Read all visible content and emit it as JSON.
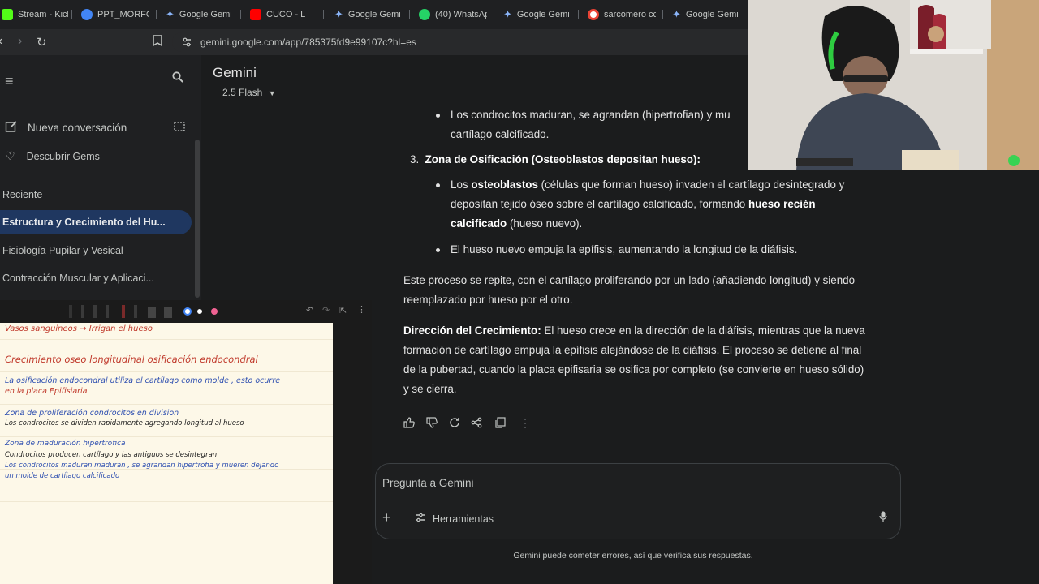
{
  "tabs": [
    {
      "label": "Stream - Kick",
      "color": "#53fc18"
    },
    {
      "label": "PPT_MORFOI",
      "color": "#4285f4"
    },
    {
      "label": "Google Gemi",
      "color": "#8ab4f8"
    },
    {
      "label": "CUCO - L",
      "color": "#ff0000"
    },
    {
      "label": "Google Gemi",
      "color": "#8ab4f8"
    },
    {
      "label": "(40) WhatsAp",
      "color": "#25d366"
    },
    {
      "label": "Google Gemi",
      "color": "#8ab4f8"
    },
    {
      "label": "sarcomero cc",
      "color": "#ea4335"
    },
    {
      "label": "Google Gemi",
      "color": "#8ab4f8"
    }
  ],
  "address": {
    "url": "gemini.google.com/app/785375fd9e99107c?hl=es"
  },
  "sidebar": {
    "new_chat": "Nueva conversación",
    "discover": "Descubrir Gems",
    "recent_header": "Reciente",
    "items": [
      "Estructura y Crecimiento del Hu...",
      "Fisiología Pupilar y Vesical",
      "Contracción Muscular y Aplicaci..."
    ]
  },
  "header": {
    "title": "Gemini",
    "model": "2.5 Flash"
  },
  "content": {
    "b1_line1": "Los condrocitos maduran, se agrandan (hipertrofian) y mu",
    "b1_line2": "cartílago calcificado.",
    "zone3_num": "3.",
    "zone3_title": "Zona de Osificación (Osteoblastos depositan hueso):",
    "b2_pre": "Los ",
    "b2_bold": "osteoblastos",
    "b2_post": " (células que forman hueso) invaden el cartílago desintegrado y",
    "b2_line2_pre": "depositan tejido óseo sobre el cartílago calcificado, formando ",
    "b2_line2_bold": "hueso recién",
    "b2_line3_bold": "calcificado",
    "b2_line3_post": " (hueso nuevo).",
    "b3": "El hueso nuevo empuja la epífisis, aumentando la longitud de la diáfisis.",
    "p1_line1": "Este proceso se repite, con el cartílago proliferando por un lado (añadiendo longitud) y siendo",
    "p1_line2": "reemplazado por hueso por el otro.",
    "p2_bold": "Dirección del Crecimiento:",
    "p2_line1": " El hueso crece en la dirección de la diáfisis, mientras que la nueva",
    "p2_line2": "formación de cartílago empuja la epífisis alejándose de la diáfisis. El proceso se detiene al final",
    "p2_line3": "de la pubertad, cuando la placa epifisaria se osifica por completo (se convierte en hueso sólido)",
    "p2_line4": "y se cierra."
  },
  "prompt": {
    "placeholder": "Pregunta a Gemini",
    "tools": "Herramientas"
  },
  "disclaimer": "Gemini puede cometer errores, así que verifica sus respuestas.",
  "notes": {
    "line1": "Vasos sanguineos → Irrigan el hueso",
    "line2": "Crecimiento oseo longitudinal   osificación endocondral",
    "line3": "La osificación endocondral utiliza el cartílago como molde , esto ocurre",
    "line4": "en la placa Epifisiaria",
    "line5": "Zona de proliferación   condrocitos en division",
    "line6": "Los condrocitos se dividen rapidamente agregando longitud al hueso",
    "line7": "Zona de maduración  hipertrofica",
    "line8": "Condrocitos producen cartílago y las antiguos se desintegran",
    "line9": "Los condrocitos maduran maduran , se agrandan hipertrofia y mueren dejando",
    "line10": "un molde de cartílago calcificado"
  }
}
